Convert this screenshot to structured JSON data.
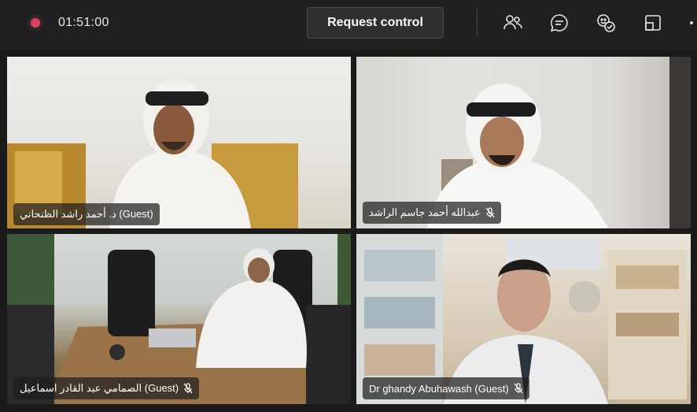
{
  "toolbar": {
    "timer": "01:51:00",
    "request_control_label": "Request control",
    "icons": [
      "record-icon",
      "participants-icon",
      "chat-icon",
      "reactions-icon",
      "share-tray-icon",
      "more-icon"
    ],
    "record_color": "#e0415a"
  },
  "participants": [
    {
      "name": "د. أحمد راشد الظنحاني (Guest)",
      "muted": false
    },
    {
      "name": "عبدالله أحمد جاسم الراشد",
      "muted": true
    },
    {
      "name": "الصمامي عبد القادر اسماعيل (Guest)",
      "muted": true
    },
    {
      "name": "Dr ghandy Abuhawash (Guest)",
      "muted": true
    }
  ]
}
